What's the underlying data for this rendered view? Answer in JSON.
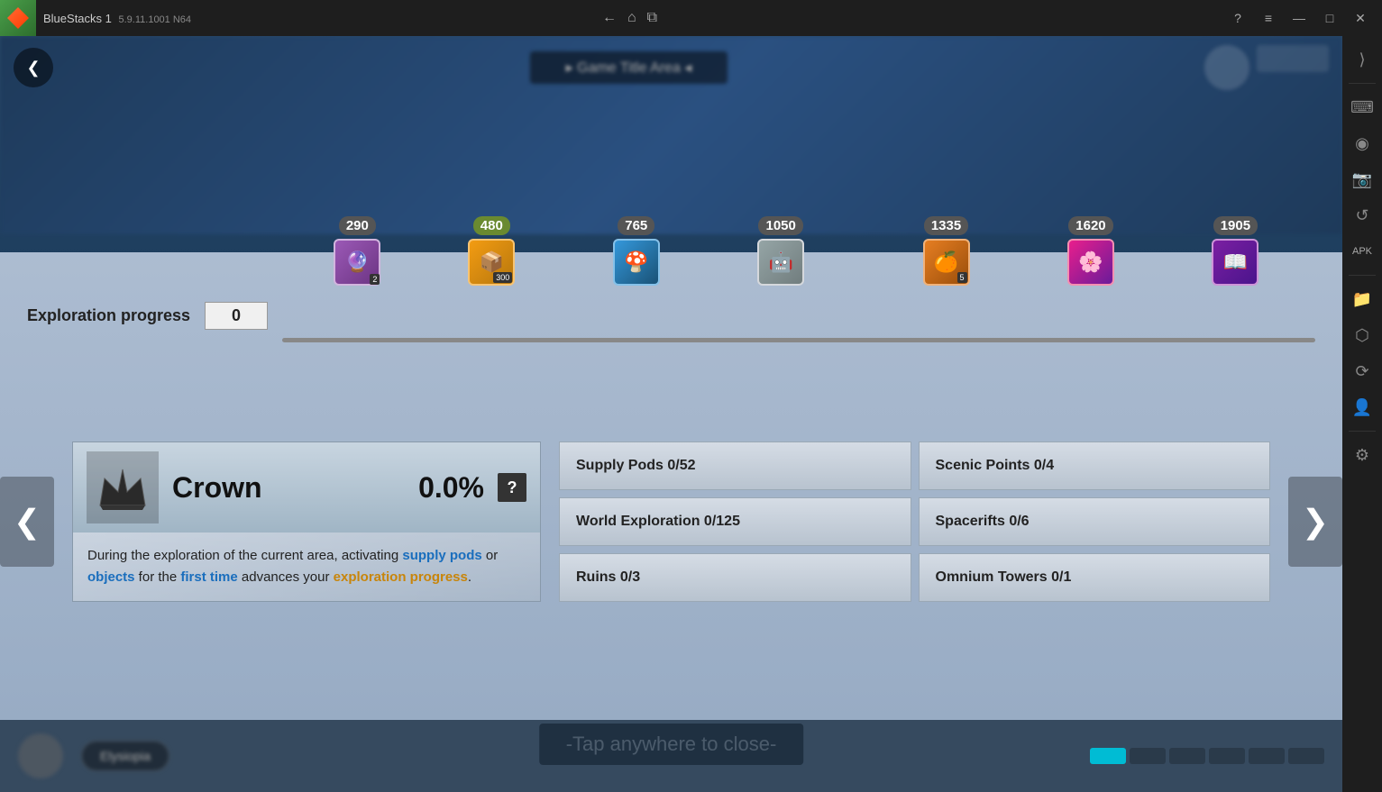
{
  "titlebar": {
    "app_name": "BlueStacks 1",
    "version": "5.9.11.1001 N64",
    "nav_back": "←",
    "nav_home": "⌂",
    "nav_stack": "⧉",
    "help_icon": "?",
    "menu_icon": "≡",
    "minimize_icon": "—",
    "maximize_icon": "□",
    "close_icon": "✕",
    "sidebar_expand": "⟨"
  },
  "right_sidebar": {
    "icons": [
      {
        "name": "expand-icon",
        "glyph": "⟩"
      },
      {
        "name": "keyboard-icon",
        "glyph": "⌨"
      },
      {
        "name": "gamepad-icon",
        "glyph": "🎮"
      },
      {
        "name": "camera-icon",
        "glyph": "📷"
      },
      {
        "name": "refresh-icon",
        "glyph": "↻"
      },
      {
        "name": "apk-icon",
        "glyph": "📦"
      },
      {
        "name": "folder-icon",
        "glyph": "📁"
      },
      {
        "name": "screenshot-icon",
        "glyph": "📸"
      },
      {
        "name": "rotate-icon",
        "glyph": "⟳"
      },
      {
        "name": "settings-icon",
        "glyph": "⚙"
      }
    ]
  },
  "exploration": {
    "label": "Exploration progress",
    "value": "0",
    "milestones": [
      {
        "value": "290",
        "icon": "🔮",
        "style": "purple",
        "badge": "2"
      },
      {
        "value": "480",
        "icon": "📦",
        "style": "gold",
        "badge": "300"
      },
      {
        "value": "765",
        "icon": "🍄",
        "style": "blue",
        "badge": ""
      },
      {
        "value": "1050",
        "icon": "🤖",
        "style": "silver",
        "badge": ""
      },
      {
        "value": "1335",
        "icon": "🍊",
        "style": "orange",
        "badge": "5"
      },
      {
        "value": "1620",
        "icon": "🌸",
        "style": "pink-purple",
        "badge": ""
      },
      {
        "value": "1905",
        "icon": "📖",
        "style": "purple2",
        "badge": ""
      }
    ]
  },
  "crown": {
    "icon": "⚔",
    "title": "Crown",
    "percentage": "0.0%",
    "question_label": "?",
    "description_parts": [
      {
        "text": "During the exploration of the current area, activating ",
        "style": "normal"
      },
      {
        "text": "supply pods",
        "style": "blue"
      },
      {
        "text": " or ",
        "style": "normal"
      },
      {
        "text": "objects",
        "style": "blue"
      },
      {
        "text": " for the ",
        "style": "normal"
      },
      {
        "text": "first time",
        "style": "blue"
      },
      {
        "text": " advances your ",
        "style": "normal"
      },
      {
        "text": "exploration progress",
        "style": "yellow"
      },
      {
        "text": ".",
        "style": "normal"
      }
    ]
  },
  "stats": [
    {
      "label": "Supply Pods 0/52",
      "id": "supply-pods"
    },
    {
      "label": "Scenic Points 0/4",
      "id": "scenic-points"
    },
    {
      "label": "World Exploration 0/125",
      "id": "world-exploration"
    },
    {
      "label": "Spacerifts 0/6",
      "id": "spacerifts"
    },
    {
      "label": "Ruins 0/3",
      "id": "ruins"
    },
    {
      "label": "Omnium Towers 0/1",
      "id": "omnium-towers"
    }
  ],
  "nav": {
    "left_arrow": "❮",
    "right_arrow": "❯"
  },
  "tap_to_close": "-Tap anywhere to close-",
  "bottom": {
    "blur_btn": "Elysiopia",
    "dots": [
      "cyan",
      "dark",
      "dark",
      "dark",
      "dark",
      "dark"
    ]
  }
}
